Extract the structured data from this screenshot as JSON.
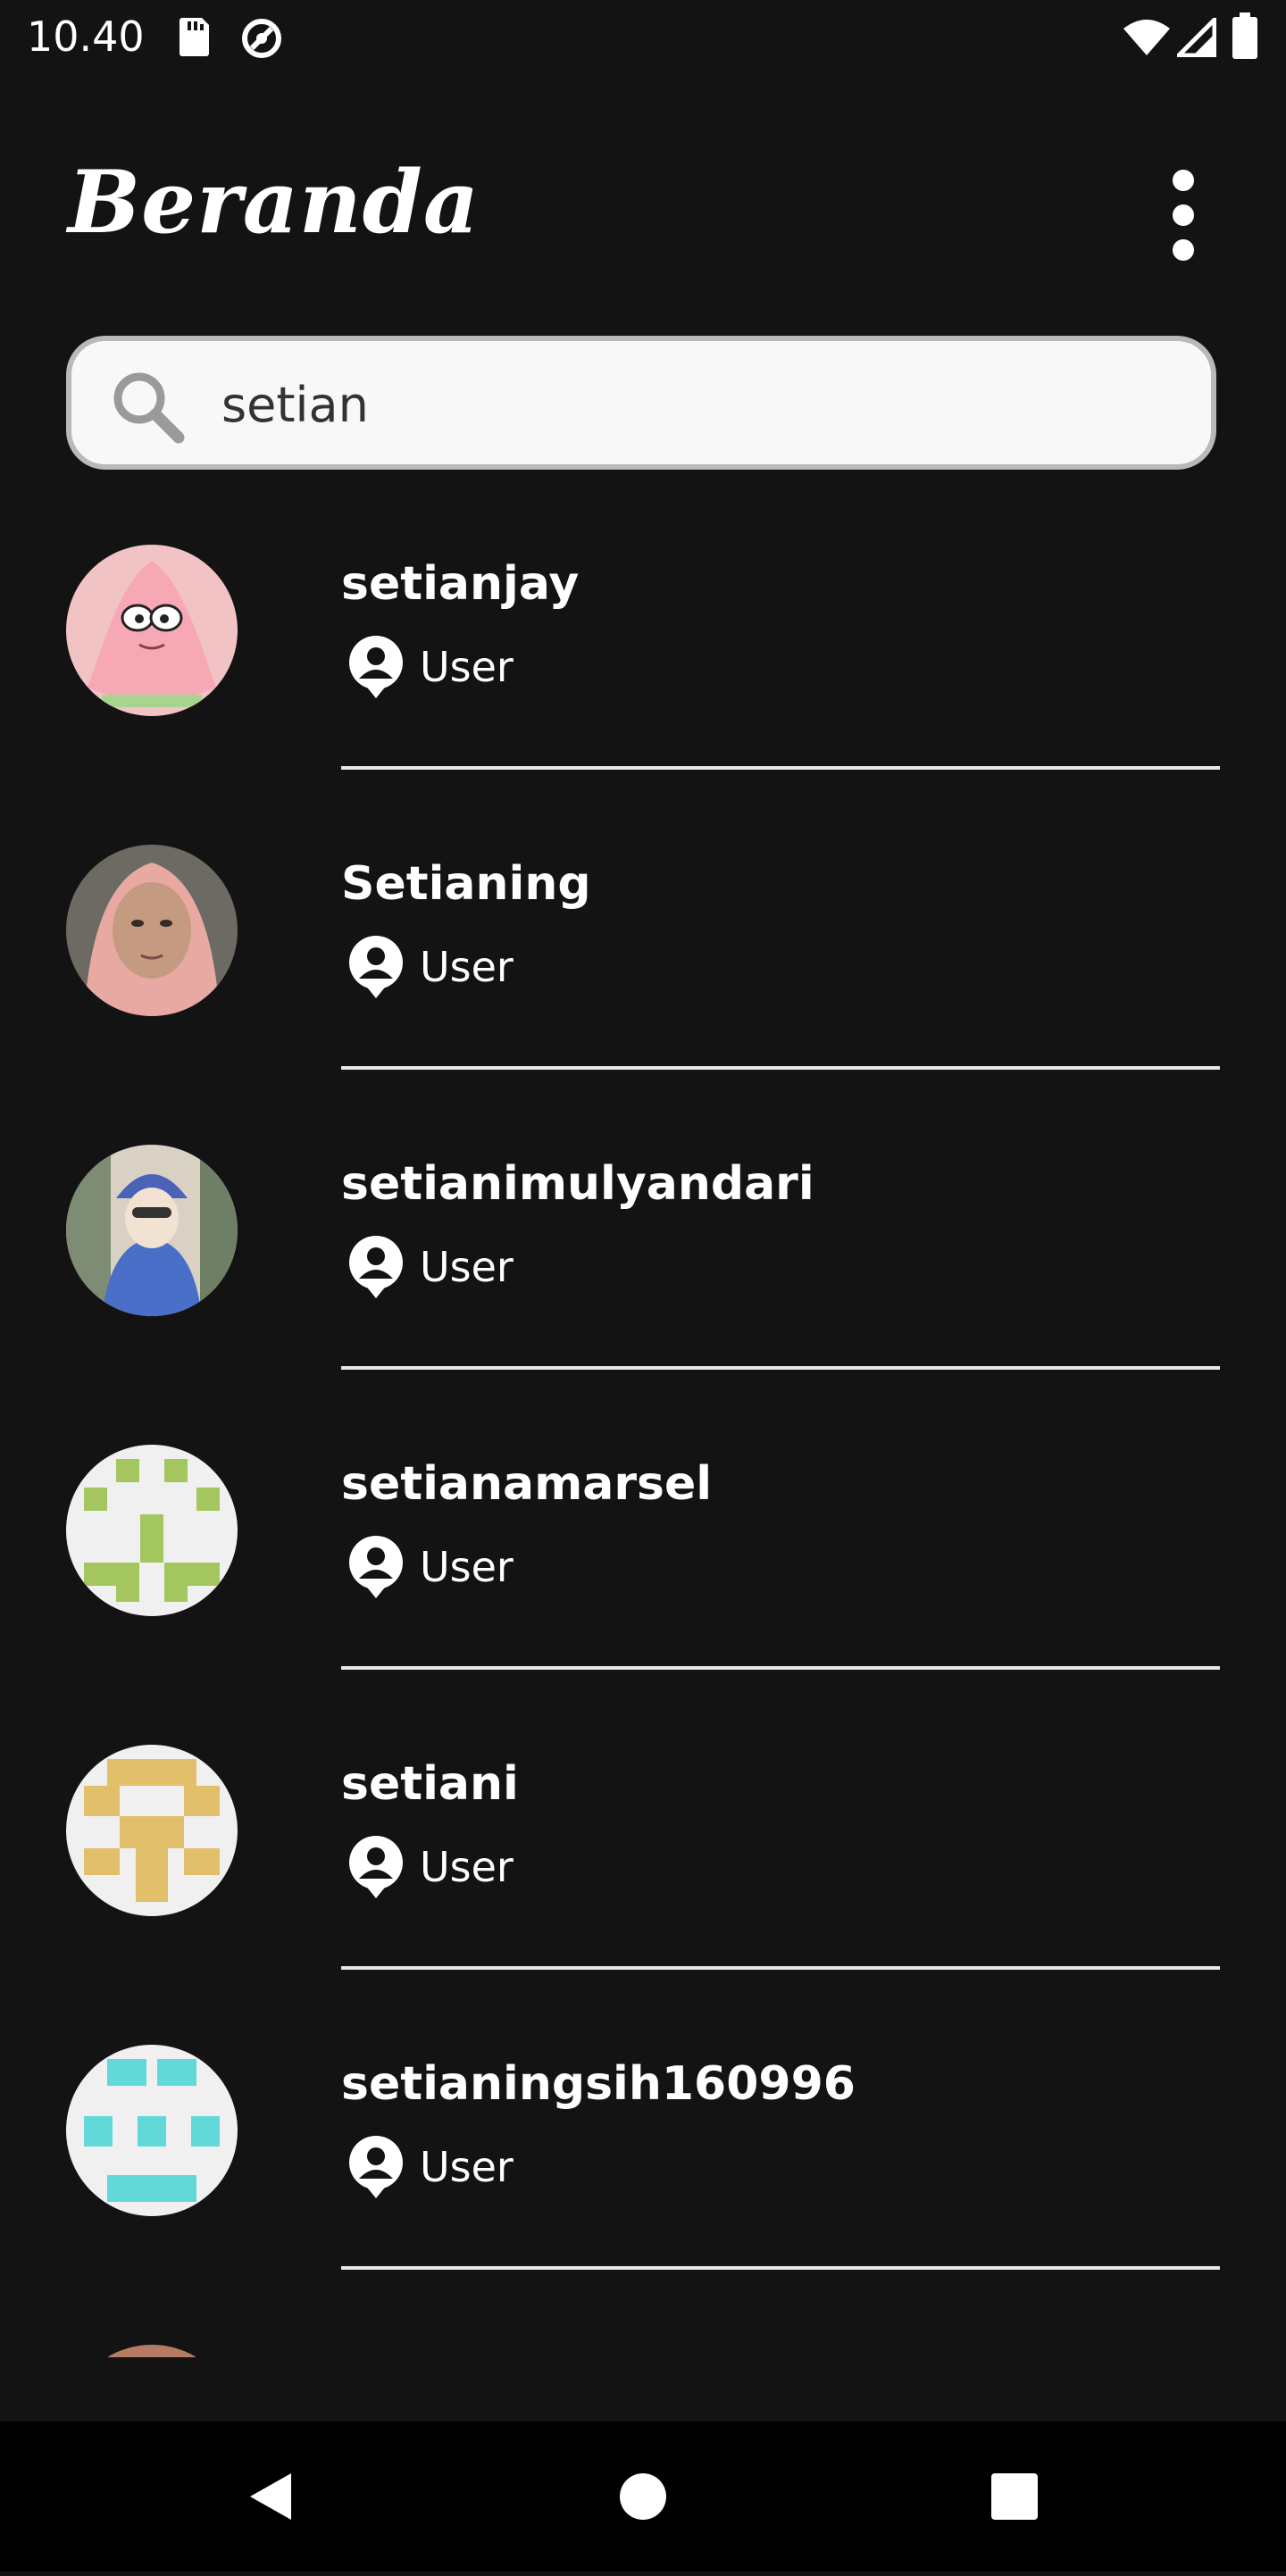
{
  "status_bar": {
    "time": "10.40",
    "left_icons": [
      "sd-card-icon",
      "do-not-disturb-icon"
    ],
    "right_icons": [
      "wifi-icon",
      "signal-icon",
      "battery-icon"
    ]
  },
  "app_bar": {
    "title": "Beranda",
    "menu_icon": "more-vert-icon"
  },
  "search": {
    "value": "setian",
    "placeholder": ""
  },
  "users": [
    {
      "name": "setianjay",
      "role": "User",
      "avatar": "patrick-avatar"
    },
    {
      "name": "Setianing",
      "role": "User",
      "avatar": "photo-avatar"
    },
    {
      "name": "setianimulyandari",
      "role": "User",
      "avatar": "photo-avatar"
    },
    {
      "name": "setianamarsel",
      "role": "User",
      "avatar": "identicon-green"
    },
    {
      "name": "setiani",
      "role": "User",
      "avatar": "identicon-yellow"
    },
    {
      "name": "setianingsih160996",
      "role": "User",
      "avatar": "identicon-cyan"
    }
  ],
  "colors": {
    "background": "#131313",
    "identicon_green": "#a4c65f",
    "identicon_yellow": "#e2bf6a",
    "identicon_cyan": "#62d8d9"
  },
  "nav_bar": {
    "icons": [
      "back-icon",
      "home-icon",
      "recents-icon"
    ]
  }
}
